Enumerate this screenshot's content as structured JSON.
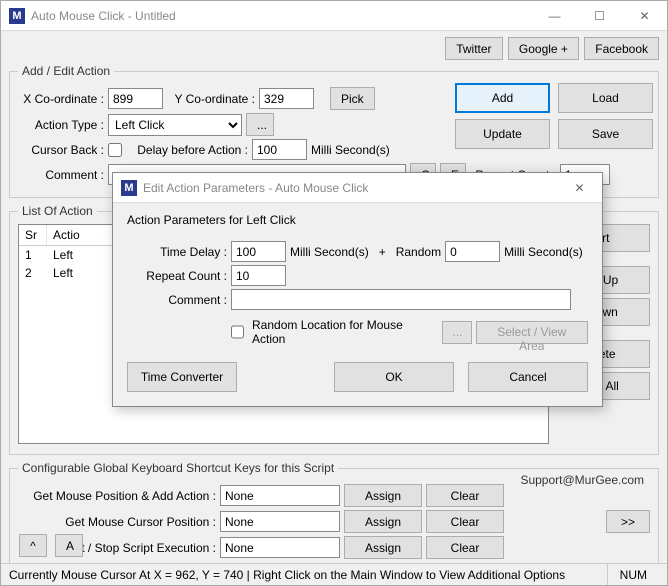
{
  "main": {
    "title": "Auto Mouse Click - Untitled",
    "icon_letter": "M",
    "social": {
      "twitter": "Twitter",
      "google": "Google +",
      "facebook": "Facebook"
    }
  },
  "add_edit": {
    "legend": "Add / Edit Action",
    "x_label": "X Co-ordinate :",
    "x_value": "899",
    "y_label": "Y Co-ordinate :",
    "y_value": "329",
    "pick": "Pick",
    "action_type_label": "Action Type :",
    "action_type_value": "Left Click",
    "ellipsis": "...",
    "cursor_back_label": "Cursor Back :",
    "delay_label": "Delay before Action :",
    "delay_value": "100",
    "delay_unit": "Milli Second(s)",
    "comment_label": "Comment :",
    "comment_value": "",
    "c_btn": "C",
    "e_btn": "E",
    "repeat_label": "Repeat Count :",
    "repeat_value": "1"
  },
  "main_buttons": {
    "add": "Add",
    "load": "Load",
    "update": "Update",
    "save": "Save"
  },
  "list": {
    "legend": "List Of Action",
    "headers": {
      "sr": "Sr",
      "action": "Actio"
    },
    "rows": [
      {
        "sr": "1",
        "action": "Left"
      },
      {
        "sr": "2",
        "action": "Left"
      }
    ],
    "side": {
      "start": "art",
      "moveup": "ve Up",
      "movedown": "Down",
      "delete": "elete",
      "deleteall": "ete All"
    }
  },
  "shortcuts": {
    "legend": "Configurable Global Keyboard Shortcut Keys for this Script",
    "support": "Support@MurGee.com",
    "rows": [
      {
        "label": "Get Mouse Position & Add Action :",
        "value": "None"
      },
      {
        "label": "Get Mouse Cursor Position :",
        "value": "None"
      },
      {
        "label": "Start / Stop Script Execution :",
        "value": "None"
      }
    ],
    "assign": "Assign",
    "clear": "Clear",
    "more": ">>"
  },
  "footer": {
    "caret": "^",
    "a": "A"
  },
  "status": {
    "text": "Currently Mouse Cursor At X = 962, Y = 740 | Right Click on the Main Window to View Additional Options",
    "num": "NUM"
  },
  "dialog": {
    "title": "Edit Action Parameters - Auto Mouse Click",
    "icon_letter": "M",
    "heading": "Action Parameters for Left Click",
    "time_delay_label": "Time Delay :",
    "time_delay_value": "100",
    "ms": "Milli Second(s)",
    "plus": "+",
    "random_label": "Random",
    "random_value": "0",
    "repeat_label": "Repeat Count :",
    "repeat_value": "10",
    "comment_label": "Comment :",
    "comment_value": "",
    "random_loc": "Random Location for Mouse Action",
    "ellipsis": "...",
    "select_area": "Select / View Area",
    "time_converter": "Time Converter",
    "ok": "OK",
    "cancel": "Cancel"
  }
}
